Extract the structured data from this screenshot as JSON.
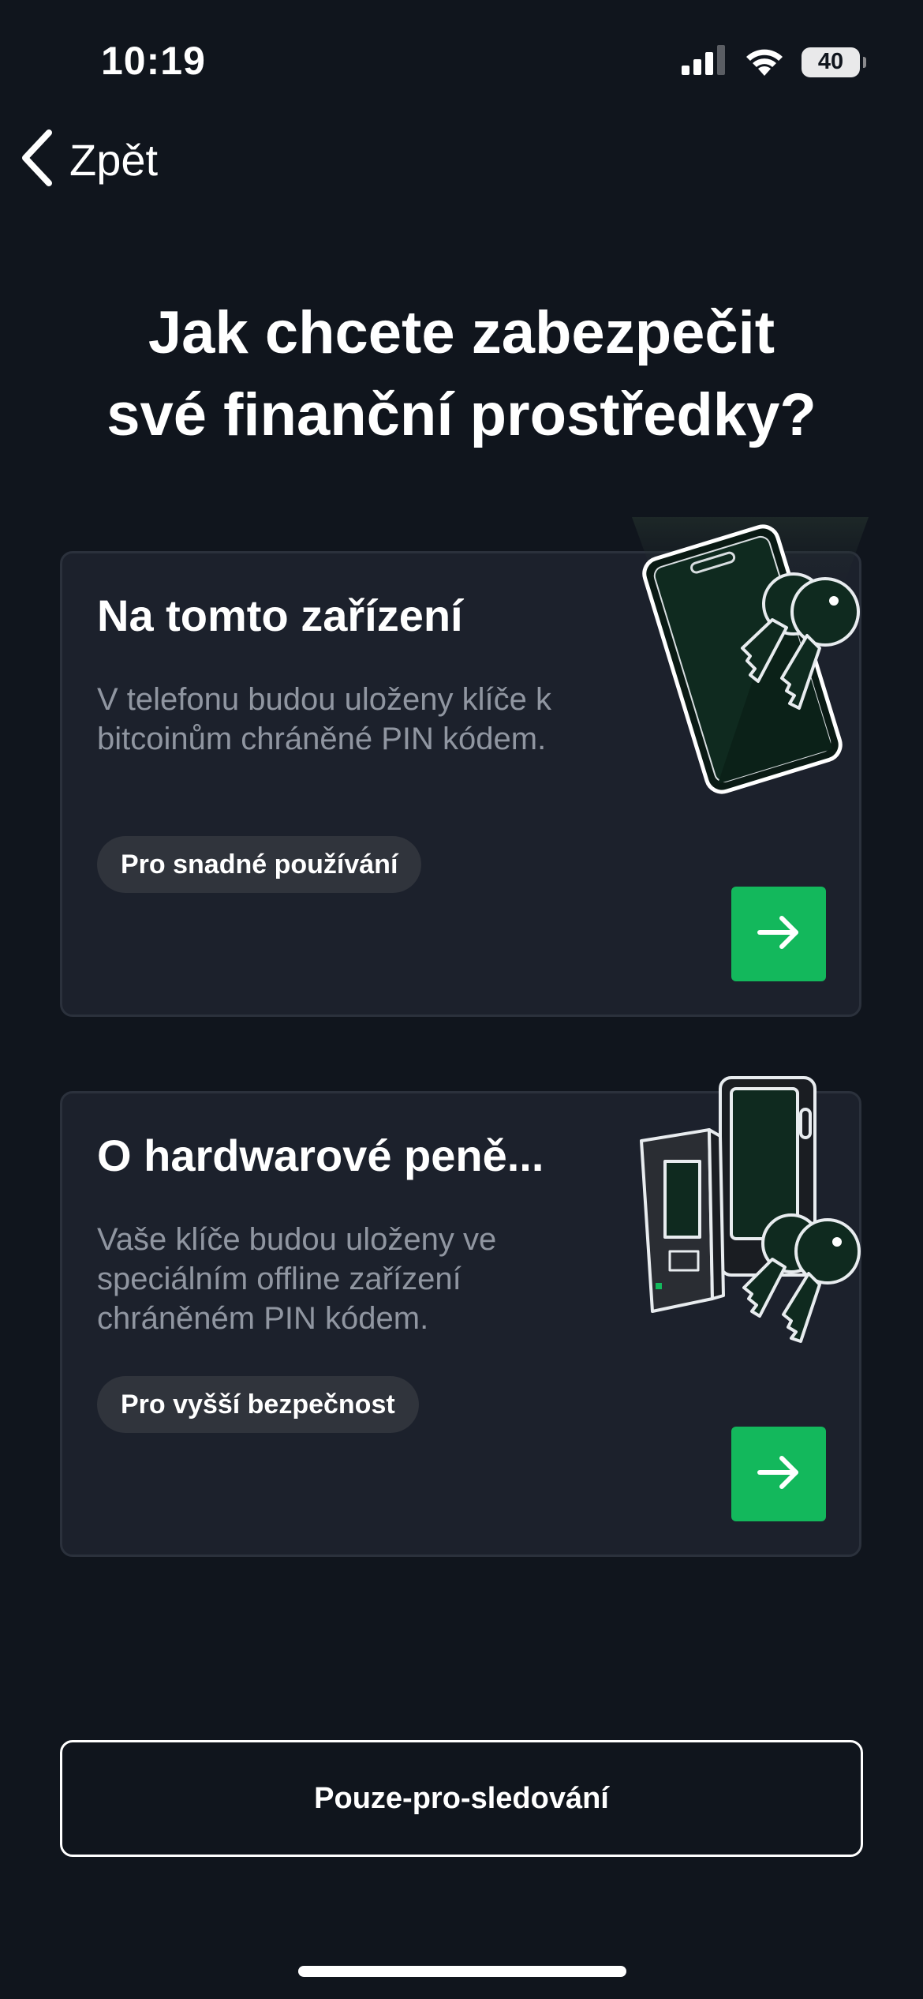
{
  "status_bar": {
    "time": "10:19",
    "battery": "40",
    "icons": [
      "signal-icon",
      "wifi-icon",
      "battery-icon"
    ]
  },
  "nav": {
    "back_label": "Zpět",
    "back_icon": "chevron-left-icon"
  },
  "title": {
    "line1": "Jak chcete zabezpečit",
    "line2": "své finanční prostředky?"
  },
  "options": [
    {
      "title": "Na tomto zařízení",
      "description": "V telefonu budou uloženy klíče k bitcoinům chráněné PIN kódem.",
      "badge": "Pro snadné používání",
      "illustration": "phone-with-keys-illustration",
      "action_icon": "arrow-right-icon"
    },
    {
      "title": "O hardwarové peně...",
      "description": "Vaše klíče budou uloženy ve speciálním offline zařízení chráněném PIN kódem.",
      "badge": "Pro vyšší bezpečnost",
      "illustration": "hardware-wallet-with-keys-illustration",
      "action_icon": "arrow-right-icon"
    }
  ],
  "watch_only": {
    "label": "Pouze-pro-sledování"
  },
  "colors": {
    "background": "#10151d",
    "card": "#1c212c",
    "accent": "#13b85c",
    "muted_text": "#9096a1",
    "badge": "#30343c"
  }
}
